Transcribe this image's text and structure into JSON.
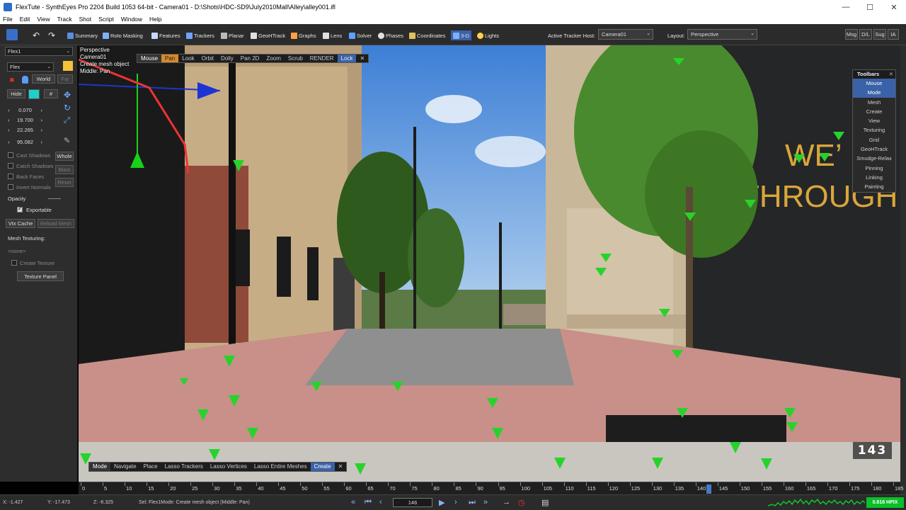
{
  "window": {
    "title": "FlexTute - SynthEyes Pro 2204 Build 1053 64-bit - Camera01 - D:\\Shots\\HDC-SD9\\July2010Mall\\Alley\\alley001.ifl",
    "min": "—",
    "max": "☐",
    "close": "✕"
  },
  "menu": [
    "File",
    "Edit",
    "View",
    "Track",
    "Shot",
    "Script",
    "Window",
    "Help"
  ],
  "toolbar": {
    "rooms": [
      {
        "label": "Summary",
        "icon": "summary-icon",
        "color": "#5a8de0"
      },
      {
        "label": "Roto Masking",
        "icon": "roto-icon",
        "color": "#7fb0ff"
      },
      {
        "label": "Features",
        "icon": "features-icon",
        "color": "#c8d8ff"
      },
      {
        "label": "Trackers",
        "icon": "trackers-icon",
        "color": "#6fa3ff"
      },
      {
        "label": "Planar",
        "icon": "planar-icon",
        "color": "#bbbbbb"
      },
      {
        "label": "GeoHTrack",
        "icon": "geohtrack-icon",
        "color": "#e0e0e0"
      },
      {
        "label": "Graphs",
        "icon": "graphs-icon",
        "color": "#ff9f40"
      },
      {
        "label": "Lens",
        "icon": "lens-icon",
        "color": "#e0e0e0"
      },
      {
        "label": "Solver",
        "icon": "solver-icon",
        "color": "#5fa0ff"
      },
      {
        "label": "Phases",
        "icon": "phases-icon",
        "color": "#e0e0e0"
      },
      {
        "label": "Coordinates",
        "icon": "coordinates-icon",
        "color": "#e0c060"
      },
      {
        "label": "3-D",
        "icon": "3d-icon",
        "color": "#7ab0ff"
      },
      {
        "label": "Lights",
        "icon": "lights-icon",
        "color": "#ffd24a"
      }
    ],
    "tracker_host_label": "Active Tracker Host:",
    "tracker_host_value": "Camera01",
    "layout_label": "Layout:",
    "layout_value": "Perspective",
    "right_buttons": [
      "Msg",
      "D/L",
      "Sug",
      "IA"
    ]
  },
  "left_panel": {
    "object_select": "Flex1",
    "type_select": "Flex",
    "world_label": "World",
    "far_label": "Far",
    "hide_label": "Hide",
    "hash_label": "#",
    "values": [
      "0.070",
      "19.700",
      "22.265",
      "95.082"
    ],
    "cast_shadows": "Cast Shadows",
    "catch_shadows": "Catch Shadows",
    "back_faces": "Back Faces",
    "invert_normals": "Invert Normals",
    "whole": "Whole",
    "blast": "Blast",
    "reset": "Reset",
    "opacity": "Opacity",
    "exportable": "Exportable",
    "vtx_cache": "Vtx Cache",
    "reload_mesh": "Reload Mesh",
    "mesh_texturing": "Mesh Texturing:",
    "none": "<none>",
    "create_texture": "Create Texture",
    "texture_panel": "Texture Panel"
  },
  "viewport": {
    "info_lines": [
      "Perspective",
      "Camera01",
      "Create mesh object",
      "Middle: Pan"
    ],
    "mouse_toolbar": [
      "Mouse",
      "Pan",
      "Look",
      "Orbit",
      "Dolly",
      "Pan 2D",
      "Zoom",
      "Scrub",
      "RENDER",
      "Lock"
    ],
    "mode_toolbar": [
      "Mode",
      "Navigate",
      "Place",
      "Lasso Trackers",
      "Lasso Vertices",
      "Lasso Entire Meshes",
      "Create"
    ],
    "frame_number": "143",
    "sign_text": [
      "WE'",
      "THROUGH"
    ],
    "toolbars_panel": {
      "title": "Toolbars",
      "items": [
        "Mouse",
        "Mode",
        "Mesh",
        "Create",
        "View",
        "Texturing",
        "Grid",
        "GeoHTrack",
        "Smudge-Relax",
        "Pinning",
        "Linking",
        "Painting"
      ],
      "selected": [
        "Mouse",
        "Mode"
      ]
    }
  },
  "timeline": {
    "ticks": [
      "0",
      "5",
      "10",
      "15",
      "20",
      "25",
      "30",
      "35",
      "40",
      "45",
      "50",
      "55",
      "60",
      "65",
      "70",
      "75",
      "80",
      "85",
      "90",
      "95",
      "100",
      "105",
      "110",
      "115",
      "120",
      "125",
      "130",
      "135",
      "140",
      "145",
      "150",
      "155",
      "160",
      "165",
      "170",
      "175",
      "180",
      "185"
    ],
    "current_frame": 143
  },
  "status": {
    "x": "X:   -1.427",
    "y": "Y:   -17.473",
    "z": "Z:   -6.325",
    "message": "Sel: Flex1Mode: Create mesh object (Middle: Pan)",
    "frame_field": "146",
    "hpix": "0.816 HPIX"
  }
}
